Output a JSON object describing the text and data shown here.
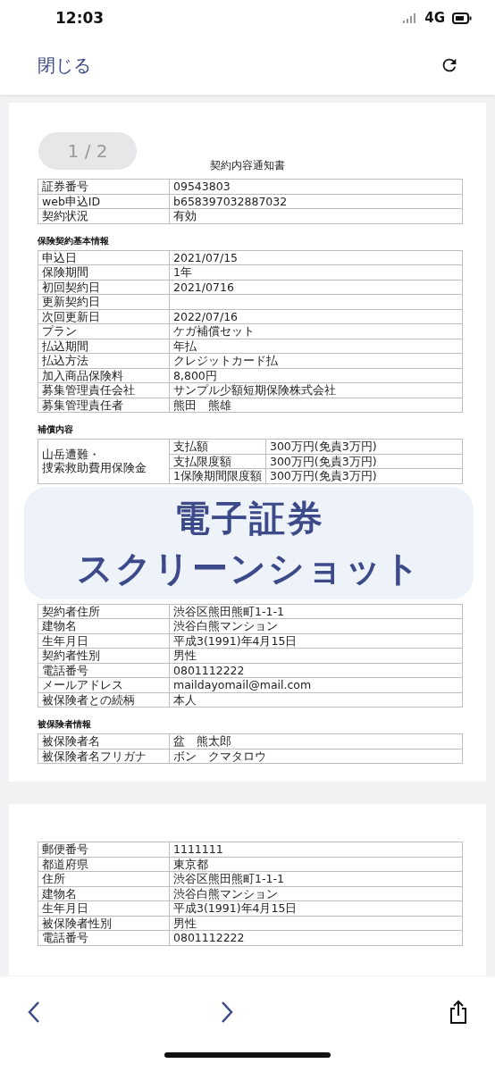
{
  "status_bar": {
    "time": "12:03",
    "network": "4G"
  },
  "header": {
    "close": "閉じる"
  },
  "page_indicator": "1 / 2",
  "page1": {
    "title": "契約内容通知書",
    "blocks": [
      {
        "kind": "table",
        "rows": [
          {
            "label": "証券番号",
            "value": "09543803"
          },
          {
            "label": "web申込ID",
            "value": "b658397032887032"
          },
          {
            "label": "契約状況",
            "value": "有効"
          }
        ]
      },
      {
        "kind": "heading",
        "text": "保険契約基本情報"
      },
      {
        "kind": "table",
        "rows": [
          {
            "label": "申込日",
            "value": "2021/07/15"
          },
          {
            "label": "保険期間",
            "value": "1年"
          },
          {
            "label": "初回契約日",
            "value": "2021/0716"
          },
          {
            "label": "更新契約日",
            "value": ""
          },
          {
            "label": "次回更新日",
            "value": "2022/07/16"
          },
          {
            "label": "プラン",
            "value": "ケガ補償セット"
          },
          {
            "label": "払込期間",
            "value": "年払"
          },
          {
            "label": "払込方法",
            "value": "クレジットカード払"
          },
          {
            "label": "加入商品保険料",
            "value": "8,800円"
          },
          {
            "label": "募集管理責任会社",
            "value": "サンプル少額短期保険株式会社"
          },
          {
            "label": "募集管理責任者",
            "value": "熊田　熊雄"
          }
        ]
      },
      {
        "kind": "heading",
        "text": "補償内容"
      },
      {
        "kind": "coverage",
        "label_lines": [
          "山岳遭難・",
          "捜索救助費用保険金"
        ],
        "rows": [
          {
            "item": "支払額",
            "value": "300万円(免責3万円)"
          },
          {
            "item": "支払限度額",
            "value": "300万円(免責3万円)"
          },
          {
            "item": "1保険期間限度額",
            "value": "300万円(免責3万円)"
          }
        ]
      },
      {
        "kind": "covered"
      },
      {
        "kind": "table",
        "rows": [
          {
            "label": "契約者住所",
            "value": "渋谷区熊田熊町1-1-1"
          },
          {
            "label": "建物名",
            "value": "渋谷白熊マンション"
          },
          {
            "label": "生年月日",
            "value": "平成3(1991)年4月15日"
          },
          {
            "label": "契約者性別",
            "value": "男性"
          },
          {
            "label": "電話番号",
            "value": "0801112222"
          },
          {
            "label": "メールアドレス",
            "value": "maildayomail@mail.com"
          },
          {
            "label": "被保険者との続柄",
            "value": "本人"
          }
        ]
      },
      {
        "kind": "heading",
        "text": "被保険者情報"
      },
      {
        "kind": "table",
        "rows": [
          {
            "label": "被保険者名",
            "value": "盆　熊太郎"
          },
          {
            "label": "被保険者名フリガナ",
            "value": "ボン　クマタロウ"
          }
        ]
      }
    ]
  },
  "page2": {
    "rows": [
      {
        "label": "郵便番号",
        "value": "1111111"
      },
      {
        "label": "都道府県",
        "value": "東京都"
      },
      {
        "label": "住所",
        "value": "渋谷区熊田熊町1-1-1"
      },
      {
        "label": "建物名",
        "value": "渋谷白熊マンション"
      },
      {
        "label": "生年月日",
        "value": "平成3(1991)年4月15日"
      },
      {
        "label": "被保険者性別",
        "value": "男性"
      },
      {
        "label": "電話番号",
        "value": "0801112222"
      }
    ]
  },
  "banner": {
    "line1": "電子証券",
    "line2": "スクリーンショット"
  }
}
